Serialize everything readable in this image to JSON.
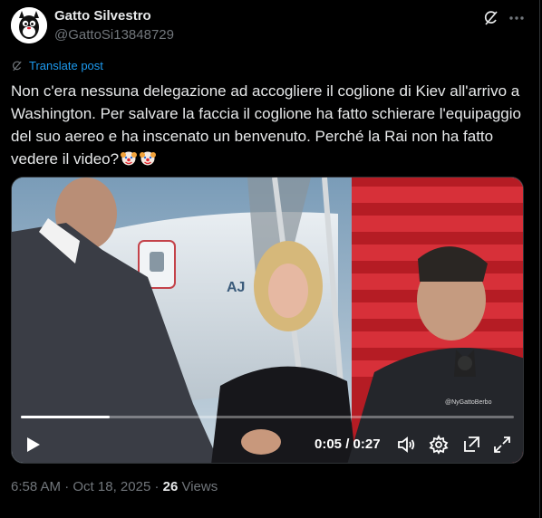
{
  "author": {
    "name": "Gatto Silvestro",
    "handle": "@GattoSi13848729"
  },
  "actions": {
    "grok_icon": "grok-icon",
    "more_icon": "more-horizontal-icon"
  },
  "translate_label": "Translate post",
  "post": {
    "text": "Non c'era nessuna delegazione ad accogliere il coglione di Kiev all'arrivo a Washington. Per salvare la faccia il coglione ha fatto schierare l'equipaggio del suo aereo e ha inscenato un benvenuto. Perché la Rai non ha fatto vedere il video?",
    "emoji": [
      "clown-face-emoji",
      "clown-face-emoji"
    ]
  },
  "video": {
    "current_time": "0:05",
    "separator": " / ",
    "duration": "0:27",
    "progress": 0.18,
    "watermark": "@NyGattoBerbo",
    "plane_text": "AJ"
  },
  "meta": {
    "time": "6:58 AM",
    "dot": " · ",
    "date": "Oct 18, 2025",
    "dot2": " · ",
    "views_count": "26",
    "views_label": " Views"
  },
  "colors": {
    "background": "#000000",
    "text": "#e7e9ea",
    "muted": "#71767b",
    "link": "#1d9bf0",
    "stairs": "#c8202a"
  }
}
